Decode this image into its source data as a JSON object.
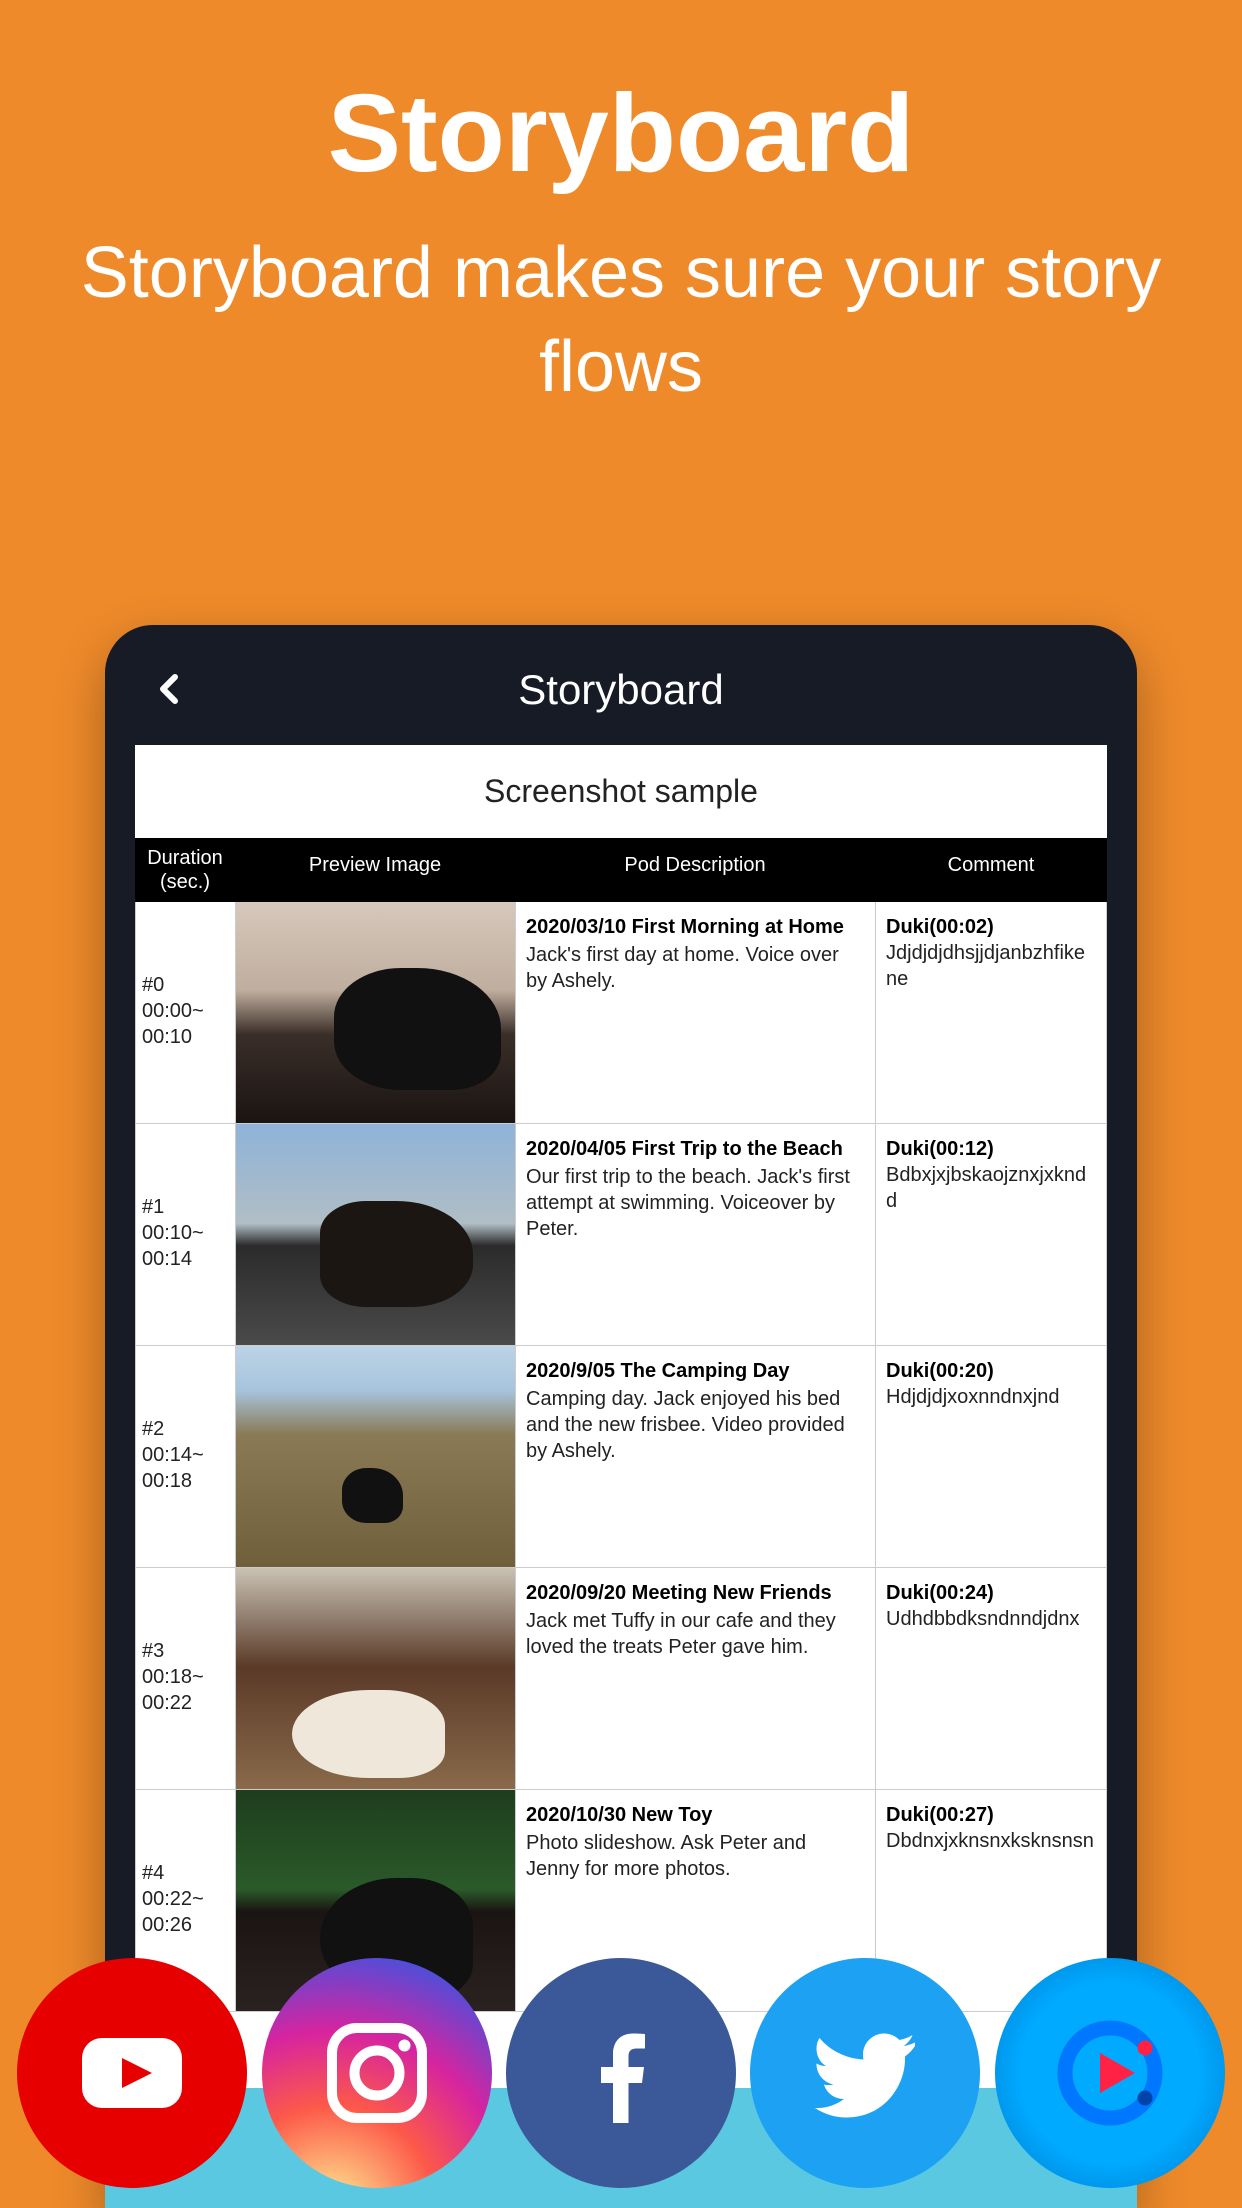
{
  "hero": {
    "title": "Storyboard",
    "subtitle": "Storyboard makes sure your story flows"
  },
  "app": {
    "title": "Storyboard",
    "sample_title": "Screenshot sample"
  },
  "table": {
    "headers": {
      "duration": "Duration (sec.)",
      "preview": "Preview Image",
      "description": "Pod Description",
      "comment": "Comment"
    },
    "rows": [
      {
        "index": "#0",
        "time": "00:00~ 00:10",
        "title": "2020/03/10 First Morning at Home",
        "body": "Jack's first day at home. Voice over by Ashely.",
        "comment_meta": "Duki(00:02)",
        "comment_body": "Jdjdjdjdhsjjdjanbzhfikene"
      },
      {
        "index": "#1",
        "time": "00:10~ 00:14",
        "title": "2020/04/05 First Trip to the Beach",
        "body": "Our first trip to the beach. Jack's first attempt at swimming. Voiceover by Peter.",
        "comment_meta": "Duki(00:12)",
        "comment_body": "Bdbxjxjbskaojznxjxknd d"
      },
      {
        "index": "#2",
        "time": "00:14~ 00:18",
        "title": "2020/9/05 The Camping Day",
        "body": "Camping day. Jack enjoyed his bed and the new frisbee. Video provided by Ashely.",
        "comment_meta": "Duki(00:20)",
        "comment_body": "Hdjdjdjxoxnndnxjnd"
      },
      {
        "index": "#3",
        "time": "00:18~ 00:22",
        "title": "2020/09/20 Meeting New Friends",
        "body": "Jack met Tuffy in our cafe and they loved the treats Peter gave him.",
        "comment_meta": "Duki(00:24)",
        "comment_body": "Udhdbbdksndnndjdnx"
      },
      {
        "index": "#4",
        "time": "00:22~ 00:26",
        "title": "2020/10/30 New Toy",
        "body": "Photo slideshow. Ask Peter and Jenny for more photos.",
        "comment_meta": "Duki(00:27)",
        "comment_body": "Dbdnxjxknsnxksknsnsn"
      }
    ]
  },
  "social": {
    "youtube": "youtube-icon",
    "instagram": "instagram-icon",
    "facebook": "facebook-icon",
    "twitter": "twitter-icon",
    "app": "app-icon"
  }
}
